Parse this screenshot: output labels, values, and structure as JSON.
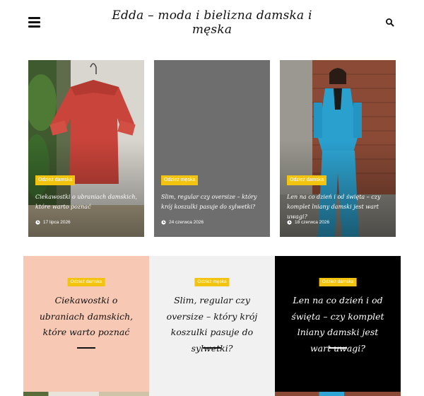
{
  "header": {
    "site_title": "Edda – moda i bielizna damska i męska",
    "menu_icon": "hamburger-menu-icon",
    "search_icon": "search-icon"
  },
  "cards": [
    {
      "category": "Odzież damska",
      "title": "Ciekawostki o ubraniach damskich, które warto poznać",
      "date": "17 lipca 2026",
      "image": "red-blouse-on-hanger"
    },
    {
      "category": "Odzież męska",
      "title": "Slim, regular czy oversize – który krój koszulki pasuje do sylwetki?",
      "date": "24 czerwca 2026",
      "image": "grey-placeholder"
    },
    {
      "category": "Odzież damska",
      "title": "Len na co dzień i od święta – czy komplet lniany damski jest wart uwagi?",
      "date": "18 czerwca 2026",
      "image": "woman-in-blue-linen-suit"
    }
  ],
  "panels": [
    {
      "category": "Odzież damska",
      "title": "Ciekawostki o ubraniach damskich, które warto poznać",
      "background": "#f7c8b4",
      "text_color": "#111111"
    },
    {
      "category": "Odzież męska",
      "title": "Slim, regular czy oversize – który krój koszulki pasuje do sylwetki?",
      "background": "#f1f1f1",
      "text_color": "#111111"
    },
    {
      "category": "Odzież damska",
      "title": "Len na co dzień i od święta – czy komplet lniany damski jest wart uwagi?",
      "background": "#000000",
      "text_color": "#ffffff"
    }
  ],
  "colors": {
    "accent": "#f2c40f"
  }
}
